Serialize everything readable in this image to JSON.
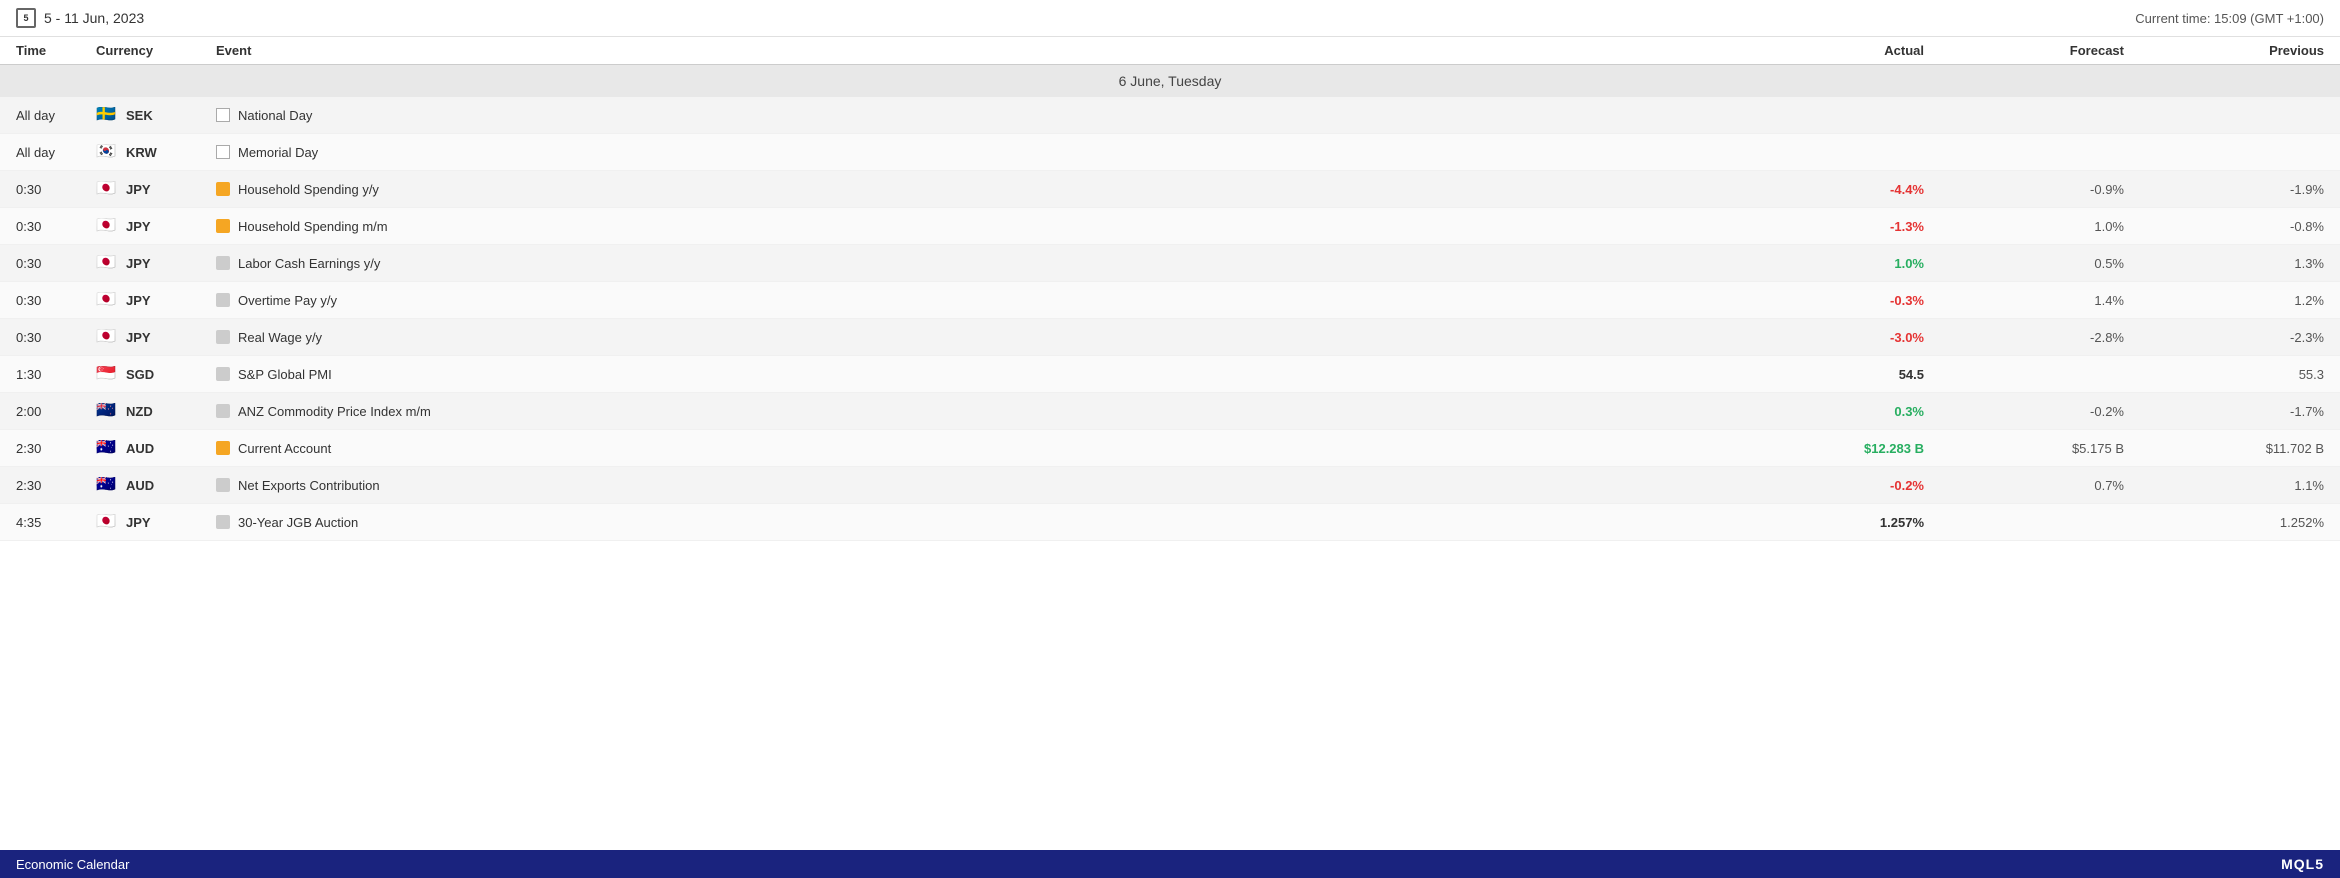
{
  "header": {
    "date_range": "5 - 11 Jun, 2023",
    "current_time_label": "Current time: 15:09 (GMT +1:00)",
    "calendar_day": "5"
  },
  "columns": {
    "time": "Time",
    "currency": "Currency",
    "event": "Event",
    "actual": "Actual",
    "forecast": "Forecast",
    "previous": "Previous"
  },
  "sections": [
    {
      "date_header": "6 June, Tuesday",
      "rows": [
        {
          "time": "All day",
          "currency": "SEK",
          "flag": "🇸🇪",
          "event": "National Day",
          "impact": "low",
          "actual": "",
          "actual_type": "neutral",
          "forecast": "",
          "previous": ""
        },
        {
          "time": "All day",
          "currency": "KRW",
          "flag": "🇰🇷",
          "event": "Memorial Day",
          "impact": "low",
          "actual": "",
          "actual_type": "neutral",
          "forecast": "",
          "previous": ""
        },
        {
          "time": "0:30",
          "currency": "JPY",
          "flag": "🇯🇵",
          "event": "Household Spending y/y",
          "impact": "high",
          "actual": "-4.4%",
          "actual_type": "negative",
          "forecast": "-0.9%",
          "previous": "-1.9%"
        },
        {
          "time": "0:30",
          "currency": "JPY",
          "flag": "🇯🇵",
          "event": "Household Spending m/m",
          "impact": "high",
          "actual": "-1.3%",
          "actual_type": "negative",
          "forecast": "1.0%",
          "previous": "-0.8%"
        },
        {
          "time": "0:30",
          "currency": "JPY",
          "flag": "🇯🇵",
          "event": "Labor Cash Earnings y/y",
          "impact": "low",
          "actual": "1.0%",
          "actual_type": "positive",
          "forecast": "0.5%",
          "previous": "1.3%"
        },
        {
          "time": "0:30",
          "currency": "JPY",
          "flag": "🇯🇵",
          "event": "Overtime Pay y/y",
          "impact": "low",
          "actual": "-0.3%",
          "actual_type": "negative",
          "forecast": "1.4%",
          "previous": "1.2%"
        },
        {
          "time": "0:30",
          "currency": "JPY",
          "flag": "🇯🇵",
          "event": "Real Wage y/y",
          "impact": "low",
          "actual": "-3.0%",
          "actual_type": "negative",
          "forecast": "-2.8%",
          "previous": "-2.3%"
        },
        {
          "time": "1:30",
          "currency": "SGD",
          "flag": "🇸🇬",
          "event": "S&P Global PMI",
          "impact": "low",
          "actual": "54.5",
          "actual_type": "neutral",
          "forecast": "",
          "previous": "55.3"
        },
        {
          "time": "2:00",
          "currency": "NZD",
          "flag": "🇳🇿",
          "event": "ANZ Commodity Price Index m/m",
          "impact": "low",
          "actual": "0.3%",
          "actual_type": "positive",
          "forecast": "-0.2%",
          "previous": "-1.7%"
        },
        {
          "time": "2:30",
          "currency": "AUD",
          "flag": "🇦🇺",
          "event": "Current Account",
          "impact": "high",
          "actual": "$12.283 B",
          "actual_type": "positive",
          "forecast": "$5.175 B",
          "previous": "$11.702 B"
        },
        {
          "time": "2:30",
          "currency": "AUD",
          "flag": "🇦🇺",
          "event": "Net Exports Contribution",
          "impact": "low",
          "actual": "-0.2%",
          "actual_type": "negative",
          "forecast": "0.7%",
          "previous": "1.1%"
        },
        {
          "time": "4:35",
          "currency": "JPY",
          "flag": "🇯🇵",
          "event": "30-Year JGB Auction",
          "impact": "low",
          "actual": "1.257%",
          "actual_type": "neutral",
          "forecast": "",
          "previous": "1.252%"
        }
      ]
    }
  ],
  "footer": {
    "title": "Economic Calendar",
    "logo": "MQL5"
  }
}
